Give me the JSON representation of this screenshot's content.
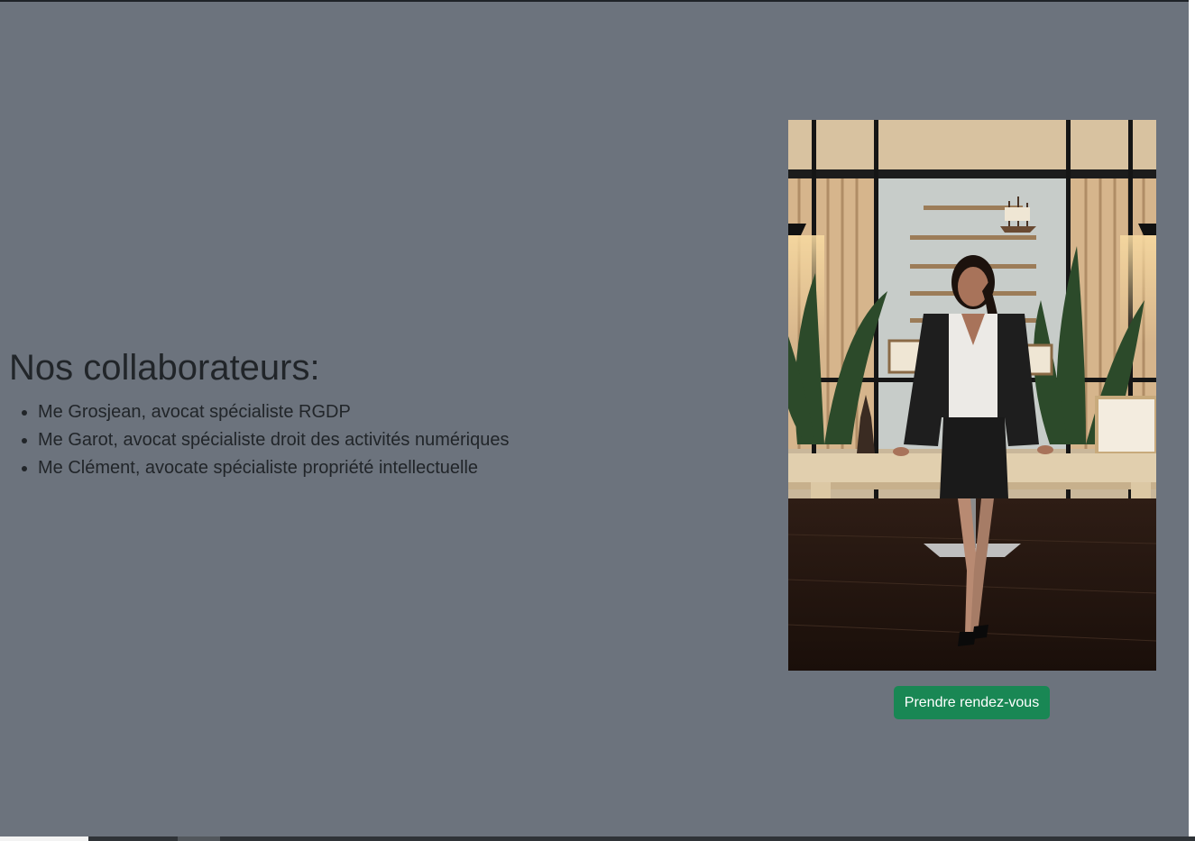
{
  "team": {
    "heading": "Nos collaborateurs:",
    "members": [
      "Me Grosjean, avocat spécialiste RGDP",
      "Me Garot, avocat spécialiste droit des activités numériques",
      "Me Clément, avocate spécialiste propriété intellectuelle"
    ]
  },
  "photo": {
    "subject": "lawyer-portrait-in-office"
  },
  "cta": {
    "label": "Prendre rendez-vous"
  },
  "colors": {
    "section_background": "#6c737d",
    "text": "#212529",
    "button": "#198754"
  }
}
